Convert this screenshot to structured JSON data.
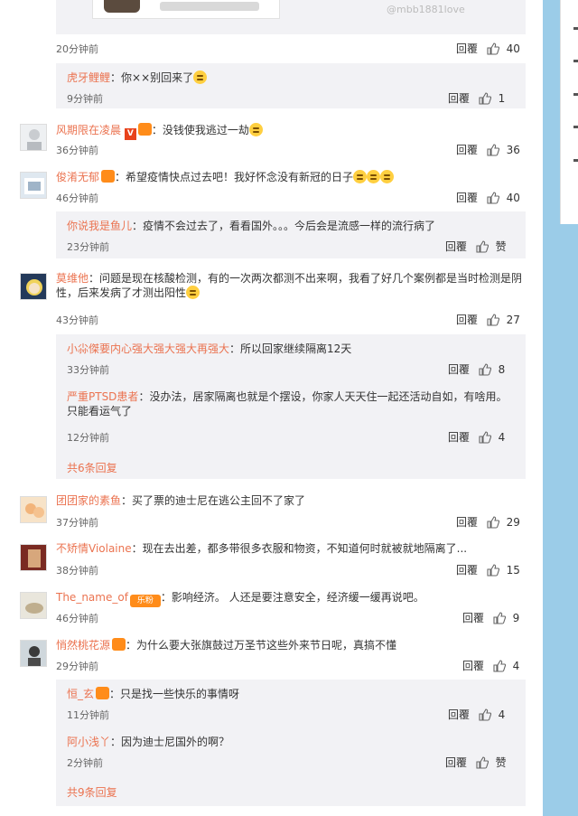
{
  "watermark": "@mbb1881love",
  "actions": {
    "reply": "回覆"
  },
  "comments": [
    {
      "time": "20分钟前",
      "likes": "40"
    },
    {
      "name": "风期限在凌晨",
      "text": "：没钱使我逃过一劫",
      "time": "36分钟前",
      "likes": "36"
    },
    {
      "name": "俊淆无郁",
      "text": "：希望疫情快点过去吧！我好怀念没有新冠的日子",
      "time": "46分钟前",
      "likes": "40"
    },
    {
      "name": "莫维他",
      "text": "：问题是现在核酸检测，有的一次两次都测不出来啊，我看了好几个案例都是当时检测是阴性，后来发病了才测出阳性",
      "time": "43分钟前",
      "likes": "27"
    },
    {
      "name": "团团家的素鱼",
      "text": "：买了票的迪士尼在逃公主回不了家了",
      "time": "37分钟前",
      "likes": "29"
    },
    {
      "name": "不矫情Violaine",
      "text": "：现在去出差，都多带很多衣服和物资，不知道何时就被就地隔离了...",
      "time": "38分钟前",
      "likes": "15"
    },
    {
      "name": "The_name_of",
      "badge": "乐粉",
      "text": "：影响经济。 人还是要注意安全，经济缓一缓再说吧。",
      "time": "46分钟前",
      "likes": "9"
    },
    {
      "name": "悄然桃花源",
      "text": "：为什么要大张旗鼓过万圣节这些外来节日呢，真搞不懂",
      "time": "29分钟前",
      "likes": "4"
    }
  ],
  "replies": [
    {
      "name": "虎牙鲤鲤",
      "text": "：你××别回来了",
      "time": "9分钟前",
      "likes": "1"
    },
    {
      "name": "你说我是鱼儿",
      "text": "：疫情不会过去了，看看国外。。。今后会是流感一样的流行病了",
      "time": "23分钟前",
      "likes": "赞"
    },
    {
      "name": "小尛傑要内心强大强大强大再强大",
      "text": "：所以回家继续隔离12天",
      "time": "33分钟前",
      "likes": "8"
    },
    {
      "name": "严重PTSD患者",
      "text": "：没办法，居家隔离也就是个摆设，你家人天天住一起还活动自如，有啥用。只能看运气了",
      "time": "12分钟前",
      "likes": "4"
    },
    {
      "name": "恒_玄",
      "text": "：只是找一些快乐的事情呀",
      "time": "11分钟前",
      "likes": "4"
    },
    {
      "name": "阿小浅丫",
      "text": "：因为迪士尼国外的啊？",
      "time": "2分钟前",
      "likes": "赞"
    }
  ],
  "more": {
    "first": "共6条回复",
    "second": "共9条回复"
  }
}
